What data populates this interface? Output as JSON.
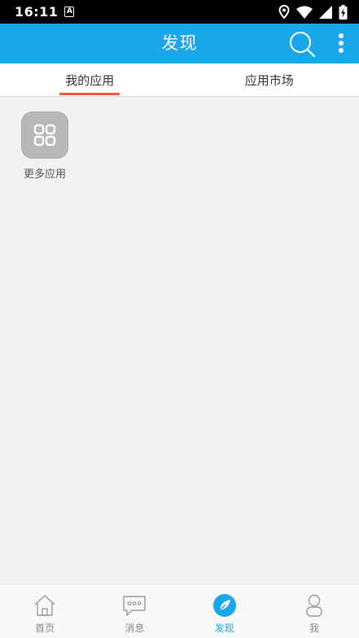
{
  "status_bar": {
    "time": "16:11",
    "badge": "A",
    "icons": [
      "location-icon",
      "wifi-icon",
      "signal-icon",
      "battery-charging-icon"
    ]
  },
  "app_bar": {
    "title": "发现",
    "icons": [
      "search-icon",
      "more-vertical-icon"
    ]
  },
  "tabs": [
    {
      "label": "我的应用",
      "active": true
    },
    {
      "label": "应用市场",
      "active": false
    }
  ],
  "apps": [
    {
      "label": "更多应用",
      "icon": "grid-apps-icon"
    }
  ],
  "bottom_nav": [
    {
      "label": "首页",
      "icon": "home-icon",
      "active": false
    },
    {
      "label": "消息",
      "icon": "message-icon",
      "active": false
    },
    {
      "label": "发现",
      "icon": "compass-icon",
      "active": true
    },
    {
      "label": "我",
      "icon": "person-icon",
      "active": false
    }
  ],
  "colors": {
    "primary": "#1aa6ea",
    "tab_indicator": "#e8573a",
    "background": "#f2f2f2",
    "tile": "#b8b8b8"
  }
}
